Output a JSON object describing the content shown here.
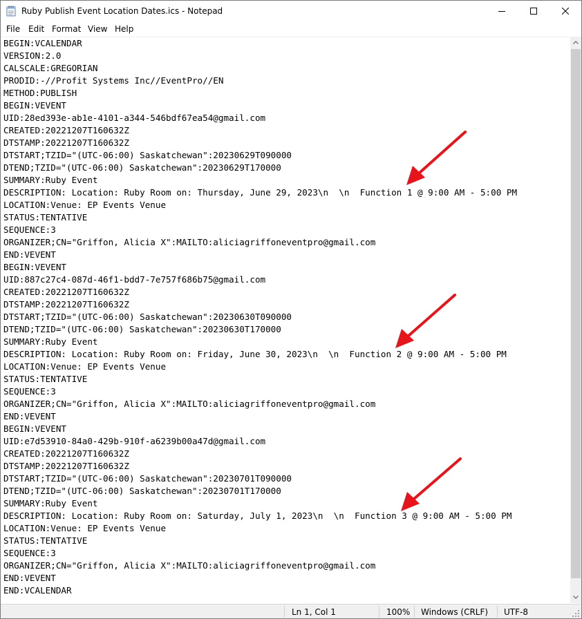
{
  "window": {
    "title": "Ruby Publish Event Location Dates.ics - Notepad",
    "app_icon": "notepad-icon",
    "controls": {
      "minimize_icon": "minimize-icon",
      "maximize_icon": "maximize-icon",
      "close_icon": "close-icon"
    }
  },
  "menu": [
    "File",
    "Edit",
    "Format",
    "View",
    "Help"
  ],
  "document": {
    "lines": [
      "BEGIN:VCALENDAR",
      "VERSION:2.0",
      "CALSCALE:GREGORIAN",
      "PRODID:-//Profit Systems Inc//EventPro//EN",
      "METHOD:PUBLISH",
      "BEGIN:VEVENT",
      "UID:28ed393e-ab1e-4101-a344-546bdf67ea54@gmail.com",
      "CREATED:20221207T160632Z",
      "DTSTAMP:20221207T160632Z",
      "DTSTART;TZID=\"(UTC-06:00) Saskatchewan\":20230629T090000",
      "DTEND;TZID=\"(UTC-06:00) Saskatchewan\":20230629T170000",
      "SUMMARY:Ruby Event",
      "DESCRIPTION: Location: Ruby Room on: Thursday, June 29, 2023\\n  \\n  Function 1 @ 9:00 AM - 5:00 PM",
      "LOCATION:Venue: EP Events Venue",
      "STATUS:TENTATIVE",
      "SEQUENCE:3",
      "ORGANIZER;CN=\"Griffon, Alicia X\":MAILTO:aliciagriffoneventpro@gmail.com",
      "END:VEVENT",
      "BEGIN:VEVENT",
      "UID:887c27c4-087d-46f1-bdd7-7e757f686b75@gmail.com",
      "CREATED:20221207T160632Z",
      "DTSTAMP:20221207T160632Z",
      "DTSTART;TZID=\"(UTC-06:00) Saskatchewan\":20230630T090000",
      "DTEND;TZID=\"(UTC-06:00) Saskatchewan\":20230630T170000",
      "SUMMARY:Ruby Event",
      "DESCRIPTION: Location: Ruby Room on: Friday, June 30, 2023\\n  \\n  Function 2 @ 9:00 AM - 5:00 PM",
      "LOCATION:Venue: EP Events Venue",
      "STATUS:TENTATIVE",
      "SEQUENCE:3",
      "ORGANIZER;CN=\"Griffon, Alicia X\":MAILTO:aliciagriffoneventpro@gmail.com",
      "END:VEVENT",
      "BEGIN:VEVENT",
      "UID:e7d53910-84a0-429b-910f-a6239b00a47d@gmail.com",
      "CREATED:20221207T160632Z",
      "DTSTAMP:20221207T160632Z",
      "DTSTART;TZID=\"(UTC-06:00) Saskatchewan\":20230701T090000",
      "DTEND;TZID=\"(UTC-06:00) Saskatchewan\":20230701T170000",
      "SUMMARY:Ruby Event",
      "DESCRIPTION: Location: Ruby Room on: Saturday, July 1, 2023\\n  \\n  Function 3 @ 9:00 AM - 5:00 PM",
      "LOCATION:Venue: EP Events Venue",
      "STATUS:TENTATIVE",
      "SEQUENCE:3",
      "ORGANIZER;CN=\"Griffon, Alicia X\":MAILTO:aliciagriffoneventpro@gmail.com",
      "END:VEVENT",
      "END:VCALENDAR"
    ]
  },
  "annotations": {
    "arrow_color": "#e8141c",
    "arrow_icon": "red-arrow-icon"
  },
  "status": {
    "position": "Ln 1, Col 1",
    "zoom": "100%",
    "line_ending": "Windows (CRLF)",
    "encoding": "UTF-8"
  }
}
